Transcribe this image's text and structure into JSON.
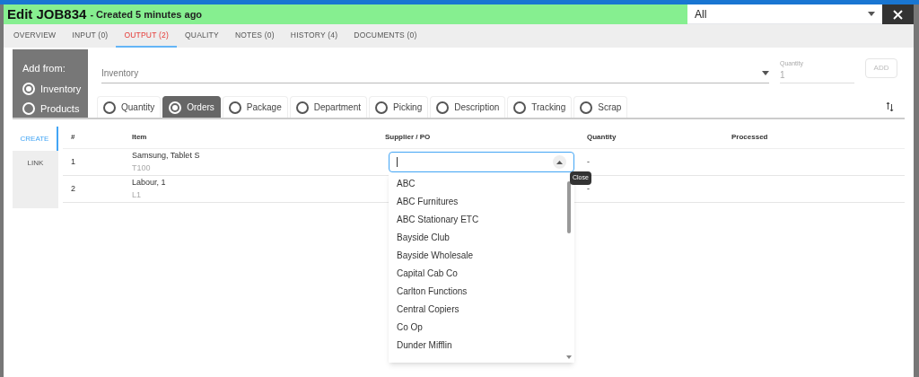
{
  "header": {
    "title": "Edit JOB834",
    "subtitle": "- Created 5 minutes ago",
    "filter": {
      "value": "All"
    }
  },
  "tabs": [
    {
      "label": "OVERVIEW",
      "selected": false
    },
    {
      "label": "INPUT (0)",
      "selected": false
    },
    {
      "label": "OUTPUT (2)",
      "selected": true
    },
    {
      "label": "QUALITY",
      "selected": false
    },
    {
      "label": "NOTES (0)",
      "selected": false
    },
    {
      "label": "HISTORY (4)",
      "selected": false
    },
    {
      "label": "DOCUMENTS (0)",
      "selected": false
    }
  ],
  "add_from": {
    "label": "Add from:",
    "options": [
      {
        "label": "Inventory",
        "selected": true
      },
      {
        "label": "Products",
        "selected": false
      }
    ]
  },
  "inventory_field": {
    "placeholder": "Inventory"
  },
  "quantity_field": {
    "label": "Quantity",
    "value": "1"
  },
  "add_button": {
    "label": "ADD",
    "disabled": true
  },
  "modes": [
    {
      "label": "Quantity",
      "selected": false
    },
    {
      "label": "Orders",
      "selected": true
    },
    {
      "label": "Package",
      "selected": false
    },
    {
      "label": "Department",
      "selected": false
    },
    {
      "label": "Picking",
      "selected": false
    },
    {
      "label": "Description",
      "selected": false
    },
    {
      "label": "Tracking",
      "selected": false
    },
    {
      "label": "Scrap",
      "selected": false
    }
  ],
  "side_tabs": [
    {
      "label": "CREATE",
      "selected": true
    },
    {
      "label": "LINK",
      "selected": false
    }
  ],
  "table": {
    "columns": [
      "#",
      "Item",
      "Supplier / PO",
      "Quantity",
      "Processed"
    ],
    "rows": [
      {
        "number": "1",
        "item": "Samsung, Tablet S",
        "code": "T100",
        "quantity": "-"
      },
      {
        "number": "2",
        "item": "Labour, 1",
        "code": "L1",
        "quantity": "-"
      }
    ]
  },
  "supplier_dropdown": {
    "tooltip": "Close",
    "options": [
      "ABC",
      "ABC Furnitures",
      "ABC Stationary ETC",
      "Bayside Club",
      "Bayside Wholesale",
      "Capital Cab Co",
      "Carlton Functions",
      "Central Copiers",
      "Co Op",
      "Dunder Mifflin"
    ]
  }
}
